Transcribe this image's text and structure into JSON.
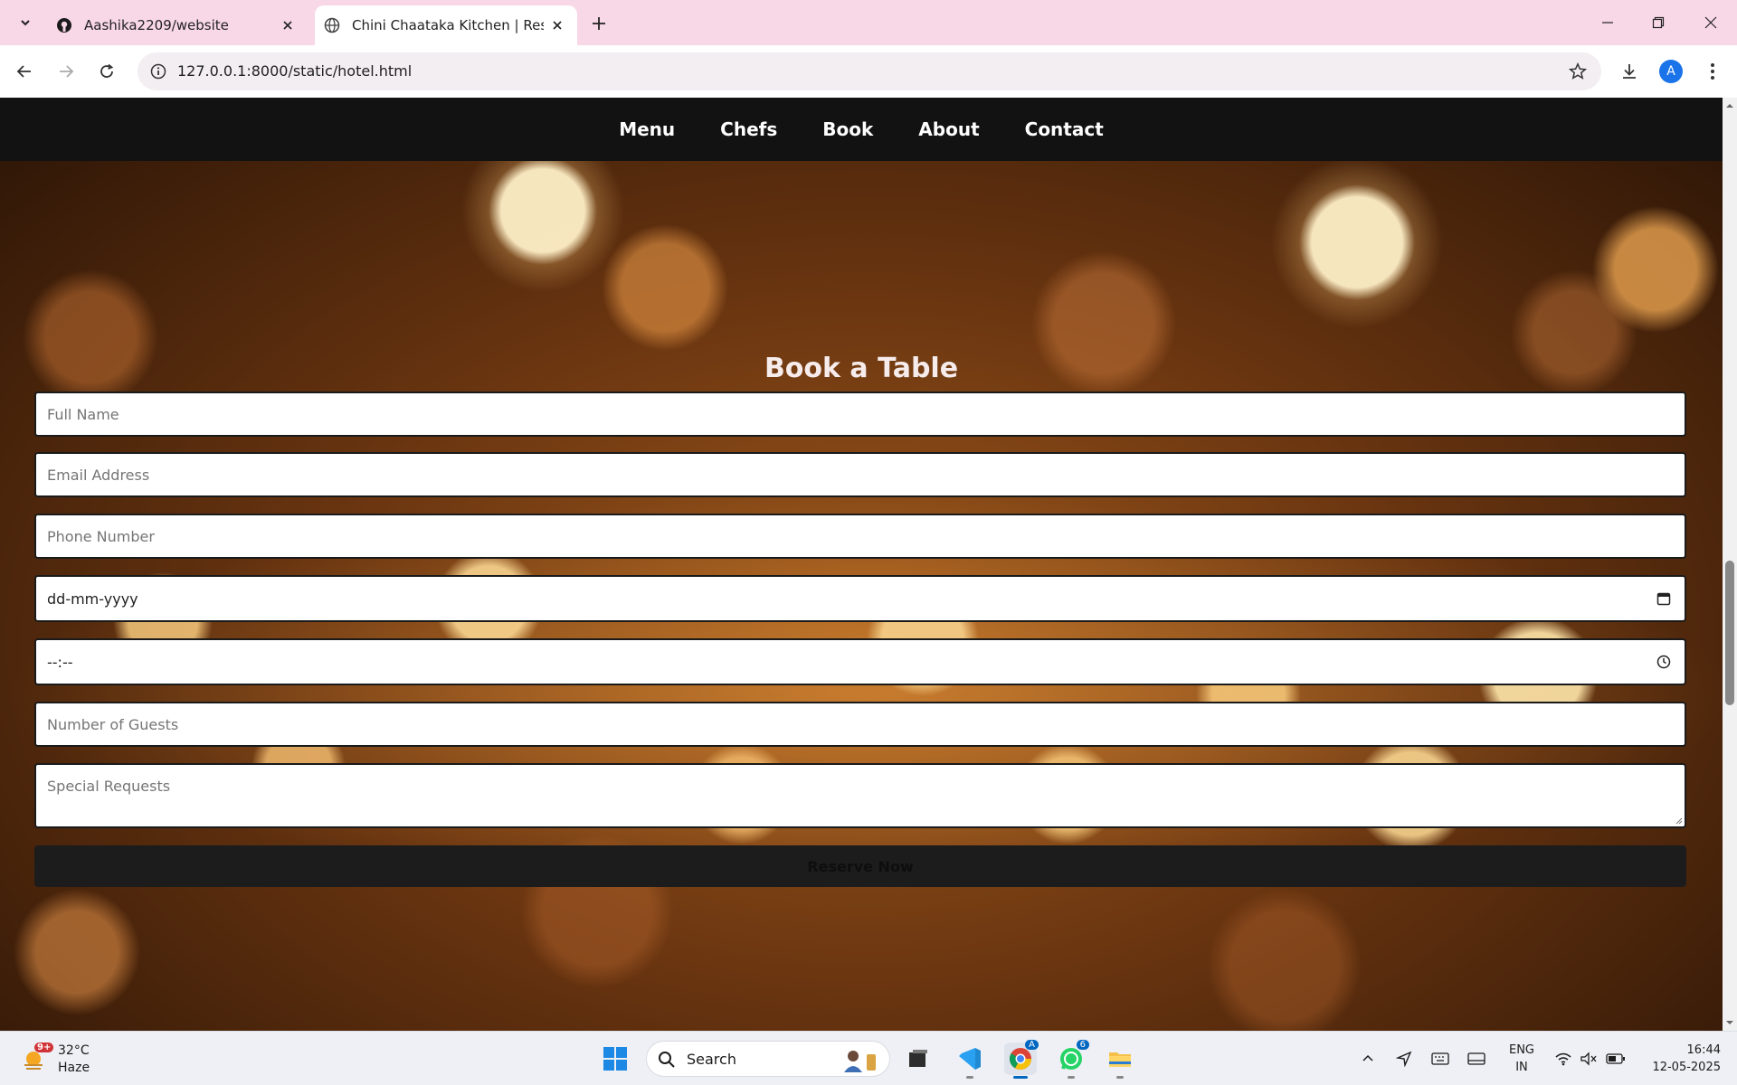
{
  "browser": {
    "tabs": [
      {
        "title": "Aashika2209/website",
        "icon": "github-icon"
      },
      {
        "title": "Chini Chaataka Kitchen | Restaurant",
        "icon": "globe-icon",
        "active": true
      }
    ],
    "url": "127.0.0.1:8000/static/hotel.html",
    "profile_initial": "A"
  },
  "site": {
    "nav": [
      "Menu",
      "Chefs",
      "Book",
      "About",
      "Contact"
    ],
    "booking": {
      "title": "Book a Table",
      "fields": {
        "full_name": "Full Name",
        "email": "Email Address",
        "phone": "Phone Number",
        "date": "dd-mm-yyyy",
        "time": "--:--",
        "guests": "Number of Guests",
        "requests": "Special Requests"
      },
      "submit_label": "Reserve Now"
    }
  },
  "taskbar": {
    "weather": {
      "temp": "32°C",
      "condition": "Haze",
      "badge": "9+"
    },
    "search_label": "Search",
    "whatsapp_count": "6",
    "chrome_profile_badge": "A",
    "language": {
      "line1": "ENG",
      "line2": "IN"
    },
    "time": "16:44",
    "date": "12-05-2025"
  },
  "colors": {
    "tabbar": "#f8d7e7",
    "site_nav": "#121212",
    "reserve_button": "#1c1c1c",
    "accent": "#1a73e8"
  }
}
